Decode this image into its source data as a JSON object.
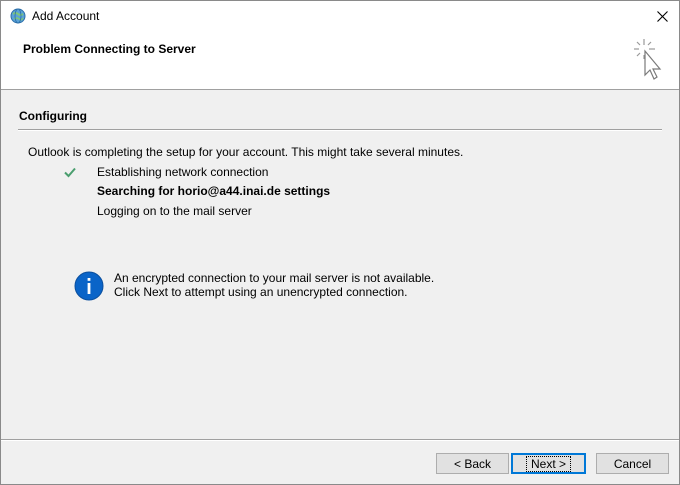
{
  "window": {
    "title": "Add Account"
  },
  "header": {
    "title": "Problem Connecting to Server"
  },
  "section": {
    "title": "Configuring"
  },
  "intro": "Outlook is completing the setup for your account. This might take several minutes.",
  "steps": [
    {
      "label": "Establishing network connection",
      "status": "done"
    },
    {
      "label": "Searching for horio@a44.inai.de settings",
      "status": "current"
    },
    {
      "label": "Logging on to the mail server",
      "status": "pending"
    }
  ],
  "info": {
    "line1": "An encrypted connection to your mail server is not available.",
    "line2": "Click Next to attempt using an unencrypted connection."
  },
  "buttons": {
    "back": "< Back",
    "next": "Next >",
    "cancel": "Cancel"
  },
  "colors": {
    "check": "#4a9e6e",
    "info": "#0a64c8",
    "default_button_border": "#0078d7"
  }
}
